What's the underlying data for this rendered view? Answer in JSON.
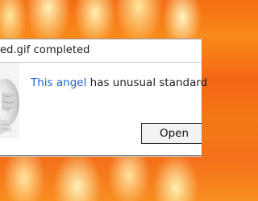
{
  "dialog": {
    "title": "ed.gif completed",
    "message_accent": "This angel",
    "message_rest": " has unusual standard",
    "open_label": "Open"
  },
  "icons": {
    "preview": "angel-thumbnail-icon"
  },
  "colors": {
    "accent": "#1f63d6",
    "background_fire": "#f46e13"
  }
}
